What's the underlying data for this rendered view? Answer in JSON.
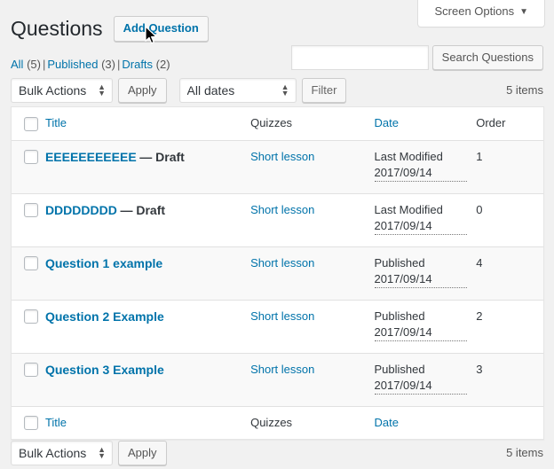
{
  "screen_meta": {
    "screen_options_label": "Screen Options",
    "caret_glyph": "▼"
  },
  "header": {
    "title": "Questions",
    "add_button_label": "Add Question"
  },
  "status_filters": {
    "items": [
      {
        "label": "All",
        "count": "(5)"
      },
      {
        "label": "Published",
        "count": "(3)"
      },
      {
        "label": "Drafts",
        "count": "(2)"
      }
    ],
    "separator": "|"
  },
  "search": {
    "value": "",
    "placeholder": "",
    "button_label": "Search Questions"
  },
  "tablenav_top": {
    "bulk_actions_selected": "Bulk Actions",
    "bulk_actions_options": [
      "Bulk Actions"
    ],
    "apply_label": "Apply",
    "dates_selected": "All dates",
    "dates_options": [
      "All dates"
    ],
    "filter_label": "Filter",
    "displaying_num": "5 items",
    "updown_glyph": "▲▼"
  },
  "tablenav_bottom": {
    "bulk_actions_selected": "Bulk Actions",
    "bulk_actions_options": [
      "Bulk Actions"
    ],
    "apply_label": "Apply",
    "displaying_num": "5 items",
    "updown_glyph": "▲▼"
  },
  "table": {
    "columns": {
      "title": "Title",
      "quizzes": "Quizzes",
      "date": "Date",
      "order": "Order"
    },
    "footer_columns": {
      "title": "Title",
      "quizzes": "Quizzes",
      "date": "Date",
      "order": ""
    },
    "rows": [
      {
        "title": "EEEEEEEEEEE",
        "state": "— Draft",
        "quizzes": "Short lesson",
        "date_status": "Last Modified",
        "date": "2017/09/14",
        "order": "1"
      },
      {
        "title": "DDDDDDDD",
        "state": "— Draft",
        "quizzes": "Short lesson",
        "date_status": "Last Modified",
        "date": "2017/09/14",
        "order": "0"
      },
      {
        "title": "Question 1 example",
        "state": "",
        "quizzes": "Short lesson",
        "date_status": "Published",
        "date": "2017/09/14",
        "order": "4"
      },
      {
        "title": "Question 2 Example",
        "state": "",
        "quizzes": "Short lesson",
        "date_status": "Published",
        "date": "2017/09/14",
        "order": "2"
      },
      {
        "title": "Question 3 Example",
        "state": "",
        "quizzes": "Short lesson",
        "date_status": "Published",
        "date": "2017/09/14",
        "order": "3"
      }
    ]
  },
  "colors": {
    "link": "#0073aa",
    "text": "#32373c",
    "page_bg": "#f1f1f1",
    "table_bg": "#ffffff",
    "row_alt_bg": "#f9f9f9",
    "border": "#e1e1e1"
  }
}
